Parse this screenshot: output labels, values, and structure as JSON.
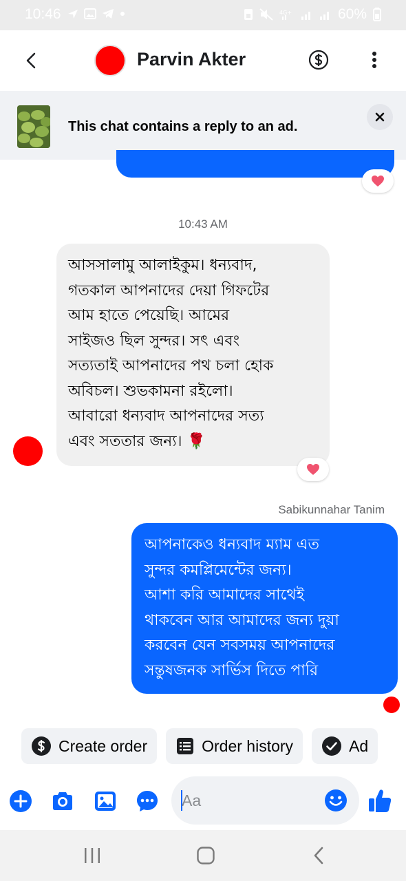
{
  "status_bar": {
    "time": "10:46",
    "battery": "60%",
    "network": "4G+"
  },
  "header": {
    "contact_name": "Parvin Akter",
    "avatar_color": "#ff0000"
  },
  "ad_banner": {
    "text": "This chat contains a reply to an ad."
  },
  "chat": {
    "timestamp": "10:43 AM",
    "incoming_message": {
      "lines": [
        "আসসালামু আলাইকুম। ধন্যবাদ,",
        "গতকাল আপনাদের দেয়া গিফটের",
        "আম হাতে পেয়েছি। আমের",
        "সাইজও ছিল সুন্দর। সৎ এবং",
        "সত্যতাই আপনাদের পথ চলা হোক",
        "অবিচল। শুভকামনা রইলো।",
        "আবারো ধন্যবাদ আপনাদের  সত্য",
        "এবং সততার জন্য। 🌹"
      ],
      "reaction": "heart"
    },
    "outgoing_sender": "Sabikunnahar Tanim",
    "outgoing_message": {
      "lines": [
        "আপনাকেও ধন্যবাদ ম্যাম এত",
        "সুন্দর কমপ্লিমেন্টের জন্য।",
        "আশা করি আমাদের সাথেই",
        "থাকবেন আর আমাদের জন্য দুয়া",
        "করবেন যেন সবসময় আপনাদের",
        "সন্তুষজনক সার্ভিস দিতে পারি"
      ]
    },
    "previous_reaction": "heart"
  },
  "quick_actions": [
    {
      "label": "Create order",
      "icon": "dollar-icon"
    },
    {
      "label": "Order history",
      "icon": "receipt-icon"
    },
    {
      "label": "Ad",
      "icon": "check-icon"
    }
  ],
  "composer": {
    "placeholder": "Aa"
  },
  "colors": {
    "accent": "#0a66ff",
    "incoming_bubble": "#f0f0f0",
    "heart": "#f0536f"
  }
}
